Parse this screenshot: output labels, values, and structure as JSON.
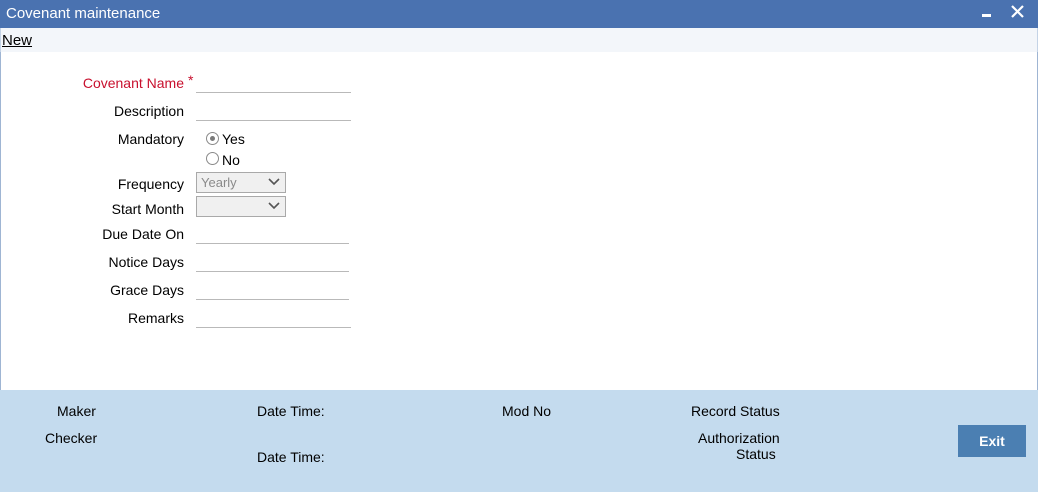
{
  "window": {
    "title": "Covenant maintenance",
    "minimize_icon": "minimize-icon",
    "close_icon": "close-icon",
    "close_glyph": "✕"
  },
  "menu": {
    "new_label": "New"
  },
  "form": {
    "covenant_name_label": "Covenant Name",
    "required_mark": "*",
    "covenant_name_value": "",
    "description_label": "Description",
    "description_value": "",
    "mandatory_label": "Mandatory",
    "mandatory_options": [
      "Yes",
      "No"
    ],
    "mandatory_selected": "Yes",
    "frequency_label": "Frequency",
    "frequency_value": "Yearly",
    "start_month_label": "Start Month",
    "start_month_value": "",
    "due_date_on_label": "Due Date On",
    "due_date_on_value": "",
    "notice_days_label": "Notice Days",
    "notice_days_value": "",
    "grace_days_label": "Grace Days",
    "grace_days_value": "",
    "remarks_label": "Remarks",
    "remarks_value": ""
  },
  "footer": {
    "maker_label": "Maker",
    "checker_label": "Checker",
    "date_time_label": "Date Time:",
    "mod_no_label": "Mod No",
    "record_status_label": "Record Status",
    "authorization_label": "Authorization",
    "status_label": "Status",
    "exit_label": "Exit"
  },
  "colors": {
    "title_bar": "#4a72b0",
    "footer": "#c4dbee",
    "required": "#c8102e",
    "exit_button": "#4b7fb2"
  }
}
